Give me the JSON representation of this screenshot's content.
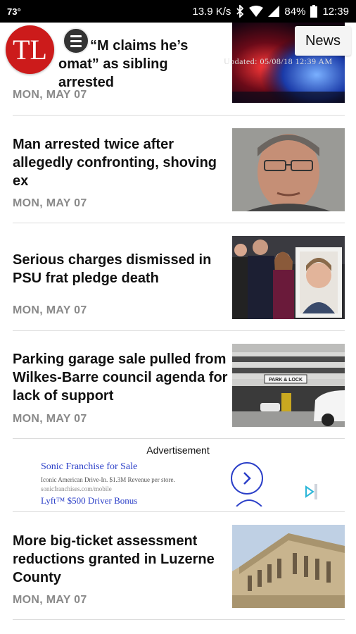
{
  "status_bar": {
    "temperature": "73°",
    "speed": "13.9 K/s",
    "battery": "84%",
    "time": "12:39"
  },
  "header": {
    "logo_text": "TL",
    "section_button": "News",
    "updated": "Updated: 05/08/18 12:39 AM"
  },
  "articles": [
    {
      "title_line1": "“M claims he’s",
      "title_line2": "omat” as sibling arrested",
      "date": "MON, MAY 07"
    },
    {
      "title": "Man arrested twice after allegedly confronting, shoving ex",
      "date": "MON, MAY 07"
    },
    {
      "title": "Serious charges dismissed in PSU frat pledge death",
      "date": "MON, MAY 07"
    },
    {
      "title": "Parking garage sale pulled from Wilkes-Barre council agenda for lack of support",
      "date": "MON, MAY 07"
    },
    {
      "title": "More big-ticket assessment reductions granted in Luzerne County",
      "date": "MON, MAY 07"
    }
  ],
  "advertisement": {
    "label": "Advertisement",
    "title": "Sonic Franchise for Sale",
    "body": "Iconic American Drive-In. $1.3M Revenue per store.",
    "url": "sonicfranchises.com/mobile",
    "next_title": "Lyft™ $500 Driver Bonus"
  },
  "garage_sign": "PARK & LOCK",
  "colors": {
    "logo_red": "#cc1b1b",
    "ad_blue": "#2b3fc8",
    "date_gray": "#8a8a8a"
  }
}
